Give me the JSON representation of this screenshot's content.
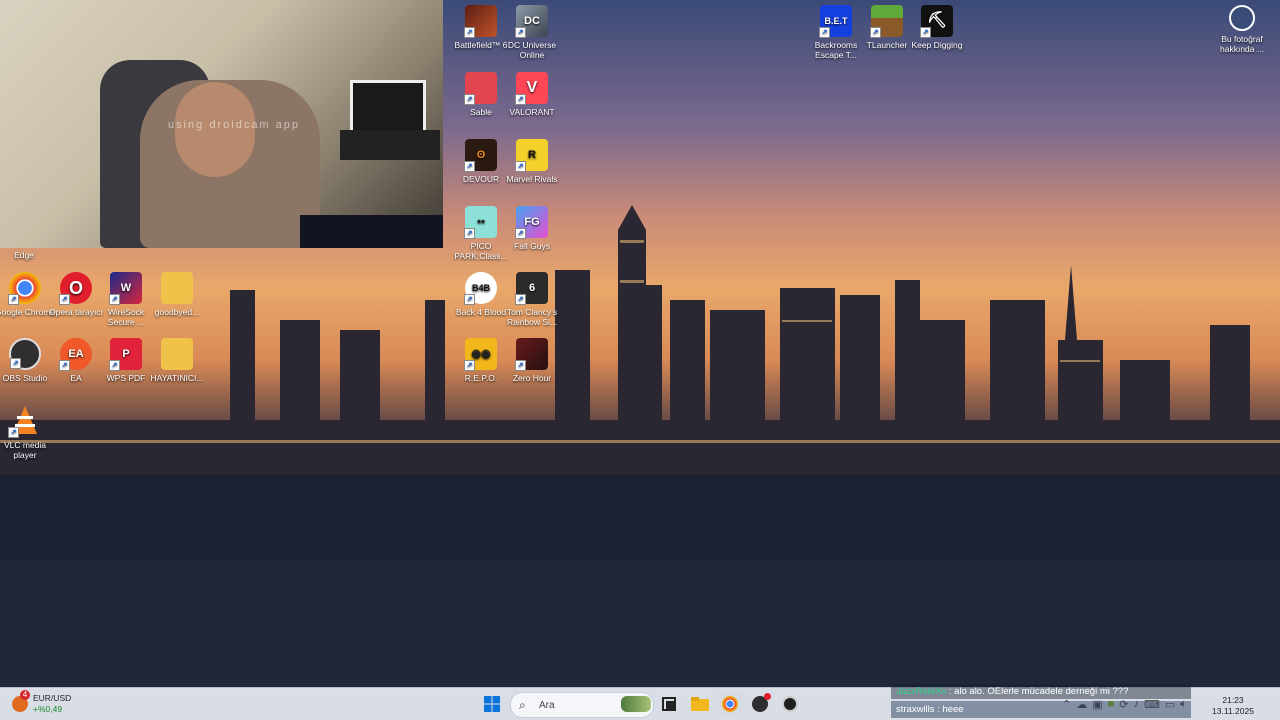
{
  "webcam": {
    "caption": "using droidcam app"
  },
  "desktop_icons": {
    "edge": "Edge",
    "chrome": "Google Chrome",
    "opera": "Opera tarayıcı",
    "wiresock": "WireSock Secure ...",
    "goodbyed": "goodbyed...",
    "obs": "OBS Studio",
    "ea": "EA",
    "wps": "WPS PDF",
    "hayatinici": "HAYATINICI...",
    "vlc": "VLC media player",
    "battlefield": "Battlefield™ 6",
    "dcuniverse": "DC Universe Online",
    "sable": "Sable",
    "valorant": "VALORANT",
    "devour": "DEVOUR",
    "marvel": "Marvel Rivals",
    "pico": "PICO PARK:Class...",
    "fallguys": "Fall Guys",
    "back4blood": "Back 4 Blood",
    "rainbow": "Tom Clancy's Rainbow Si...",
    "repo": "R.E.P.O.",
    "zerohour": "Zero Hour",
    "backrooms": "Backrooms Escape T...",
    "tlauncher": "TLauncher",
    "keepdigging": "Keep Digging",
    "photo_about": "Bu fotoğraf hakkında ..."
  },
  "taskbar": {
    "widget": {
      "badge": "4",
      "title": "EUR/USD",
      "value": "+%0,49"
    },
    "search_placeholder": "Ara",
    "clock_time": "21:23",
    "clock_date": "13.11.2025"
  },
  "chat": [
    {
      "user": "JazzRelaXx",
      "text": " : alo alo. OElerle mücadele derneği mi ???"
    },
    {
      "user": "straxwills",
      "text": " : heee"
    }
  ],
  "colors": {
    "accent": "#0067c0",
    "chat_user": "#2fd18a"
  }
}
